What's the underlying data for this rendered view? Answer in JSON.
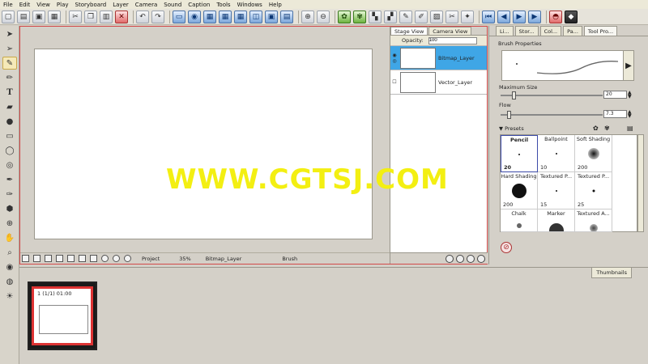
{
  "menu": [
    "File",
    "Edit",
    "View",
    "Play",
    "Storyboard",
    "Layer",
    "Camera",
    "Sound",
    "Caption",
    "Tools",
    "Windows",
    "Help"
  ],
  "toolbar_icons": [
    "new-icon",
    "open-icon",
    "save-icon",
    "save-as-icon",
    "cut-icon",
    "copy-icon",
    "paste-icon",
    "delete-icon",
    "undo-icon",
    "redo-icon",
    "stage-view-icon",
    "camera-icon",
    "grid-icon",
    "grid2-icon",
    "grid3-icon",
    "onion-icon",
    "frame-icon",
    "frame2-icon",
    "zoom-in-icon",
    "zoom-out-icon",
    "brush-icon",
    "brush2-icon",
    "caption-icon",
    "caption2-icon",
    "edit-icon",
    "edit2-icon",
    "camera2-icon",
    "scissors-icon",
    "tools-icon",
    "first-frame-icon",
    "prev-frame-icon",
    "play-icon",
    "next-frame-icon",
    "mirror-icon",
    "record-icon"
  ],
  "left_tools": [
    "select-icon",
    "pointer-icon",
    "brush-icon",
    "pencil-icon",
    "text-icon",
    "eraser-icon",
    "smudge-icon",
    "rectangle-icon",
    "ellipse-icon",
    "lasso-icon",
    "pen-icon",
    "dropper-icon",
    "bucket-icon",
    "target-icon",
    "hand-icon",
    "zoom-icon",
    "stamp-icon",
    "magnet-icon",
    "bulb-icon"
  ],
  "stage": {
    "tabs": [
      "Stage View",
      "Camera View"
    ],
    "status": {
      "project": "Project",
      "zoom": "35%",
      "layer": "Bitmap_Layer",
      "tool": "Brush"
    }
  },
  "layers": {
    "opacity_label": "Opacity:",
    "opacity_value": "100",
    "items": [
      {
        "name": "Bitmap_Layer",
        "selected": true
      },
      {
        "name": "Vector_Layer",
        "selected": false
      }
    ]
  },
  "right_panel": {
    "tabs": [
      "Li...",
      "Stor...",
      "Col...",
      "Pa...",
      "Tool Pro..."
    ],
    "title": "Brush Properties",
    "max_size_label": "Maximum Size",
    "max_size_value": "20",
    "flow_label": "Flow",
    "flow_value": "7.3",
    "presets_label": "Presets",
    "presets": [
      {
        "name": "Pencil",
        "size": "20",
        "dot": 2,
        "selected": true
      },
      {
        "name": "Ballpoint",
        "size": "10",
        "dot": 1.5,
        "selected": false
      },
      {
        "name": "Soft Shading",
        "size": "200",
        "dot": 12,
        "selected": false
      },
      {
        "name": "Hard Shading",
        "size": "200",
        "dot": 18,
        "selected": false
      },
      {
        "name": "Textured P...",
        "size": "15",
        "dot": 1.5,
        "selected": false
      },
      {
        "name": "Textured P...",
        "size": "25",
        "dot": 2.5,
        "selected": false
      },
      {
        "name": "Chalk",
        "size": "",
        "dot": 6,
        "selected": false
      },
      {
        "name": "Marker",
        "size": "",
        "dot": 18,
        "selected": false
      },
      {
        "name": "Textured A...",
        "size": "",
        "dot": 10,
        "selected": false
      }
    ]
  },
  "timeline": {
    "thumbnails_tab": "Thumbnails",
    "frame_caption": "1 (1/1) 01:00"
  },
  "watermark": "WWW.CGTSJ.COM"
}
